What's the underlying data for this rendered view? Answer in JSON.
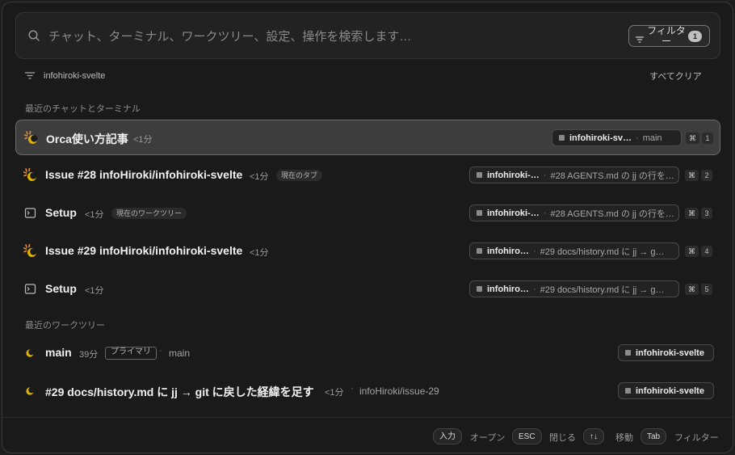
{
  "search": {
    "placeholder": "チャット、ターミナル、ワークツリー、設定、操作を検索します…",
    "value": ""
  },
  "filter_button": {
    "label": "フィルター",
    "count": "1"
  },
  "active_filter": {
    "label": "infohiroki-svelte",
    "clear_all": "すべてクリア"
  },
  "sections": {
    "recent_chats": "最近のチャットとターミナル",
    "recent_worktrees": "最近のワークツリー"
  },
  "recent_items": [
    {
      "icon": "spinner-moon-icon",
      "title": "Orca使い方記事",
      "time": "<1分",
      "tag": "",
      "repo": "infohiroki-sv…",
      "branch": "main",
      "shortcut": "1",
      "selected": true
    },
    {
      "icon": "spinner-moon-icon",
      "title": "Issue #28 infoHiroki/infohiroki-svelte",
      "time": "<1分",
      "tag": "現在のタブ",
      "repo": "infohiroki-…",
      "branch": "#28 AGENTS.md の jj の行を…",
      "shortcut": "2",
      "selected": false
    },
    {
      "icon": "terminal-icon",
      "title": "Setup",
      "time": "<1分",
      "tag": "現在のワークツリー",
      "repo": "infohiroki-…",
      "branch": "#28 AGENTS.md の jj の行を…",
      "shortcut": "3",
      "selected": false
    },
    {
      "icon": "spinner-moon-icon",
      "title": "Issue #29 infoHiroki/infohiroki-svelte",
      "time": "<1分",
      "tag": "",
      "repo": "infohiro…",
      "branch": "#29 docs/history.md に jj → g…",
      "shortcut": "4",
      "selected": false
    },
    {
      "icon": "terminal-icon",
      "title": "Setup",
      "time": "<1分",
      "tag": "",
      "repo": "infohiro…",
      "branch": "#29 docs/history.md に jj → g…",
      "shortcut": "5",
      "selected": false
    }
  ],
  "shortcut_modifier": "⌘",
  "worktrees": [
    {
      "icon": "moon-icon",
      "title": "main",
      "time": "39分",
      "tag": "プライマリ",
      "branch": "main",
      "repo": "infohiroki-svelte"
    },
    {
      "icon": "moon-icon",
      "title": "#29 docs/history.md に jj → git に戻した経緯を足す",
      "time": "<1分",
      "tag": "",
      "branch": "infoHiroki/issue-29",
      "repo": "infohiroki-svelte"
    }
  ],
  "footer": {
    "enter_key": "入力",
    "enter_label": "オープン",
    "esc_key": "ESC",
    "esc_label": "閉じる",
    "arrows_key": "↑↓",
    "arrows_label": "移動",
    "tab_key": "Tab",
    "tab_label": "フィルター"
  },
  "colors": {
    "background": "#1a1a1a",
    "selected_row": "#3d3d3d",
    "accent_yellow": "#e0b400",
    "spinner_orange": "#e38b3a"
  }
}
